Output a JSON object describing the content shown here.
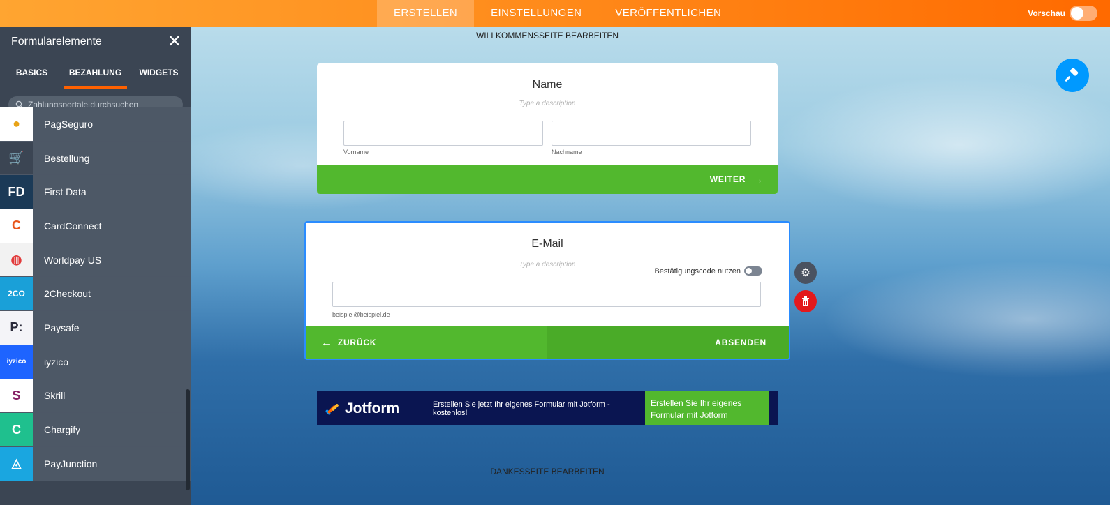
{
  "topbar": {
    "tabs": [
      {
        "label": "ERSTELLEN",
        "active": true
      },
      {
        "label": "EINSTELLUNGEN",
        "active": false
      },
      {
        "label": "VERÖFFENTLICHEN",
        "active": false
      }
    ],
    "preview_label": "Vorschau"
  },
  "sidebar": {
    "title": "Formularelemente",
    "tabs": [
      {
        "label": "BASICS",
        "active": false
      },
      {
        "label": "BEZAHLUNG",
        "active": true
      },
      {
        "label": "WIDGETS",
        "active": false
      }
    ],
    "search_placeholder": "Zahlungsportale durchsuchen",
    "items": [
      {
        "label": "PagSeguro",
        "icon": "pagseguro-icon",
        "bg": "#ffffff",
        "fg": "#e8a317",
        "glyph": "●"
      },
      {
        "label": "Bestellung",
        "icon": "shopping-cart-icon",
        "bg": "#3b4553",
        "fg": "#ffffff",
        "glyph": "🛒"
      },
      {
        "label": "First Data",
        "icon": "first-data-icon",
        "bg": "#1b3a57",
        "fg": "#ffffff",
        "glyph": "FD"
      },
      {
        "label": "CardConnect",
        "icon": "cardconnect-icon",
        "bg": "#ffffff",
        "fg": "#e8561c",
        "glyph": "C"
      },
      {
        "label": "Worldpay US",
        "icon": "worldpay-icon",
        "bg": "#f2f2f2",
        "fg": "#e23b3b",
        "glyph": "◍"
      },
      {
        "label": "2Checkout",
        "icon": "2checkout-icon",
        "bg": "#1aa0d8",
        "fg": "#ffffff",
        "glyph": "2CO"
      },
      {
        "label": "Paysafe",
        "icon": "paysafe-icon",
        "bg": "#f4f4f8",
        "fg": "#2a2a3a",
        "glyph": "P:"
      },
      {
        "label": "iyzico",
        "icon": "iyzico-icon",
        "bg": "#1e64ff",
        "fg": "#ffffff",
        "glyph": "iyzico"
      },
      {
        "label": "Skrill",
        "icon": "skrill-icon",
        "bg": "#ffffff",
        "fg": "#862165",
        "glyph": "S"
      },
      {
        "label": "Chargify",
        "icon": "chargify-icon",
        "bg": "#1fc08e",
        "fg": "#ffffff",
        "glyph": "C"
      },
      {
        "label": "PayJunction",
        "icon": "payjunction-icon",
        "bg": "#1aa6e0",
        "fg": "#ffffff",
        "glyph": "◬"
      }
    ]
  },
  "canvas": {
    "welcome_divider": "WILLKOMMENSSEITE BEARBEITEN",
    "thanks_divider": "DANKESSEITE BEARBEITEN",
    "name_card": {
      "title": "Name",
      "description": "Type a description",
      "first_label": "Vorname",
      "last_label": "Nachname",
      "next_label": "WEITER"
    },
    "email_card": {
      "title": "E-Mail",
      "description": "Type a description",
      "verify_label": "Bestätigungscode nutzen",
      "example": "beispiel@beispiel.de",
      "back_label": "ZURÜCK",
      "submit_label": "ABSENDEN"
    },
    "jotform": {
      "brand": "Jotform",
      "message": "Erstellen Sie jetzt Ihr eigenes Formular mit Jotform - kostenlos!",
      "cta": "Erstellen Sie Ihr eigenes Formular mit Jotform"
    }
  },
  "colors": {
    "accent_orange": "#ff6100",
    "green": "#52b82e",
    "sidebar_bg": "#3b4553",
    "jotform_navy": "#0a1551",
    "delete_red": "#e3191c",
    "designer_blue": "#0099ff"
  }
}
